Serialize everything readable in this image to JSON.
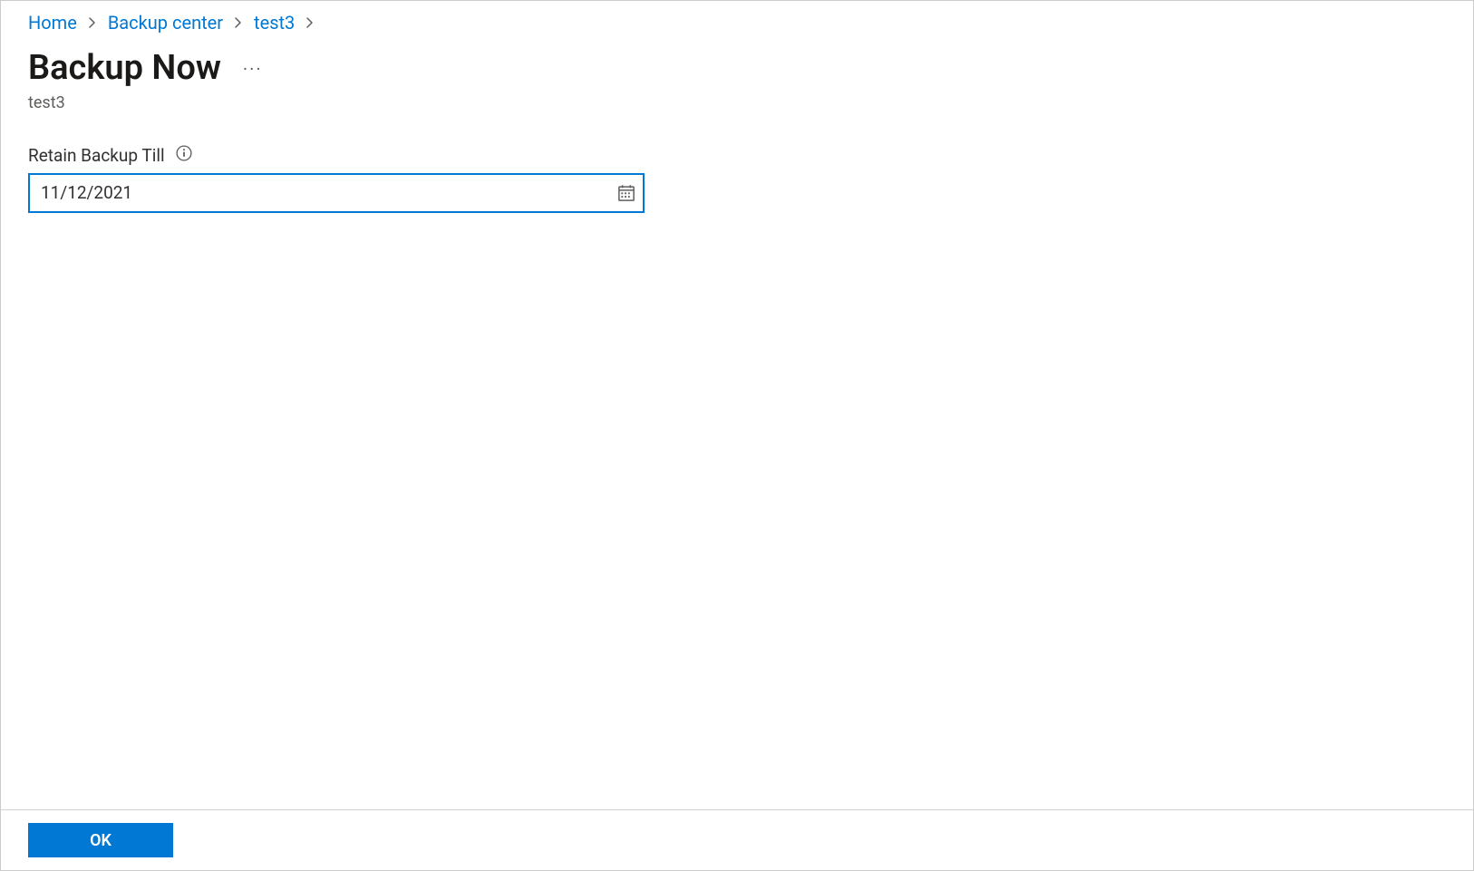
{
  "breadcrumb": {
    "items": [
      {
        "label": "Home"
      },
      {
        "label": "Backup center"
      },
      {
        "label": "test3"
      }
    ]
  },
  "header": {
    "title": "Backup Now",
    "subtitle": "test3"
  },
  "form": {
    "retain_label": "Retain Backup Till",
    "retain_value": "11/12/2021"
  },
  "footer": {
    "ok_label": "OK"
  },
  "colors": {
    "accent": "#0078d4",
    "link": "#0078d4"
  }
}
